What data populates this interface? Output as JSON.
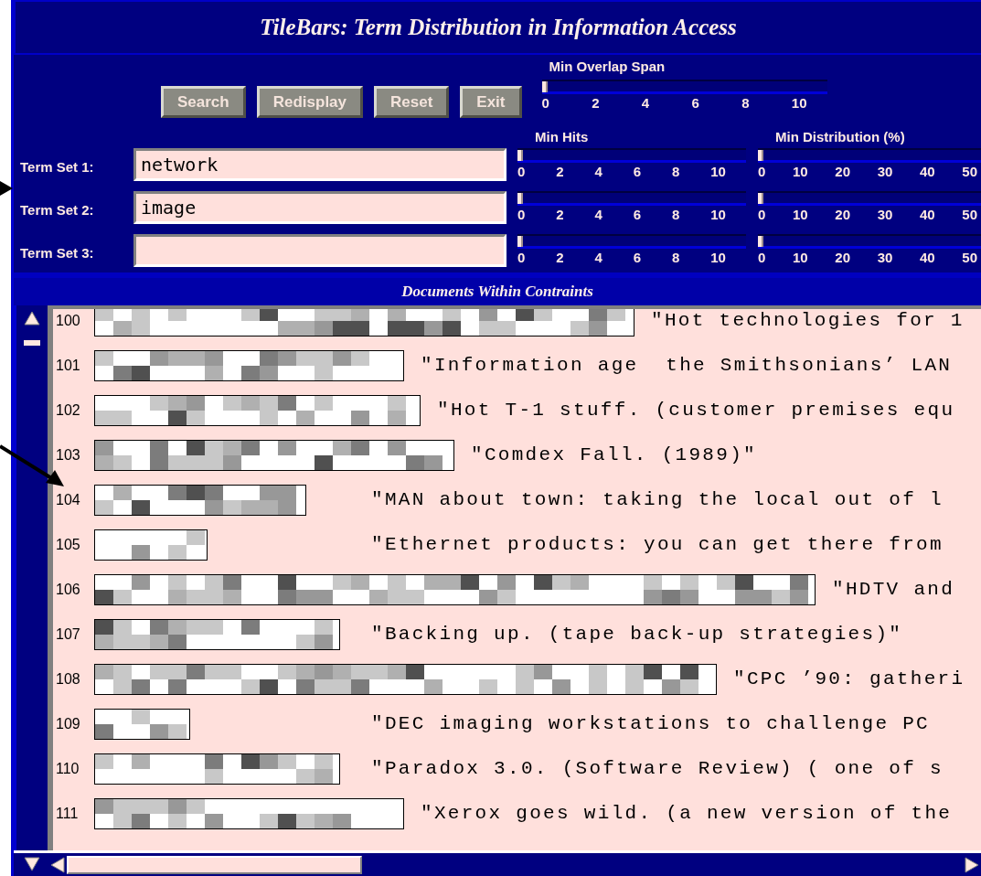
{
  "window": {
    "title": "TileBars: Term Distribution in Information Access"
  },
  "buttons": [
    "Search",
    "Redisplay",
    "Reset",
    "Exit"
  ],
  "overlap_slider": {
    "label": "Min Overlap Span",
    "level": 0,
    "ticks": [
      "0",
      "2",
      "4",
      "6",
      "8",
      "10"
    ]
  },
  "column_labels": {
    "min_hits": "Min Hits",
    "min_distribution": "Min Distribution (%)"
  },
  "term_sets": [
    {
      "label": "Term Set 1:",
      "value": "network",
      "min_hits": {
        "level": 0,
        "ticks": [
          "0",
          "2",
          "4",
          "6",
          "8",
          "10"
        ]
      },
      "min_distribution": {
        "level": 0,
        "ticks": [
          "0",
          "10",
          "20",
          "30",
          "40",
          "50"
        ]
      }
    },
    {
      "label": "Term Set 2:",
      "value": "image",
      "min_hits": {
        "level": 0,
        "ticks": [
          "0",
          "2",
          "4",
          "6",
          "8",
          "10"
        ]
      },
      "min_distribution": {
        "level": 0,
        "ticks": [
          "0",
          "10",
          "20",
          "30",
          "40",
          "50"
        ]
      }
    },
    {
      "label": "Term Set 3:",
      "min_hits": {
        "level": 0,
        "ticks": [
          "0",
          "2",
          "4",
          "6",
          "8",
          "10"
        ]
      },
      "min_distribution": {
        "level": 0,
        "ticks": [
          "0",
          "10",
          "20",
          "30",
          "40",
          "50"
        ]
      }
    }
  ],
  "results": {
    "header": "Documents Within Contraints",
    "rows": [
      {
        "number": "100",
        "title": "\"Hot technologies for 1"
      },
      {
        "number": "101",
        "title": "\"Information age  the Smithsonians’ LAN"
      },
      {
        "number": "102",
        "title": "\"Hot T-1 stuff. (customer premises equ"
      },
      {
        "number": "103",
        "title": "\"Comdex Fall. (1989)\""
      },
      {
        "number": "104",
        "title": "\"MAN about town: taking the local out of l"
      },
      {
        "number": "105",
        "title": "\"Ethernet products: you can get there from"
      },
      {
        "number": "106",
        "title": "\"HDTV and"
      },
      {
        "number": "107",
        "title": "\"Backing up. (tape back-up strategies)\""
      },
      {
        "number": "108",
        "title": "\"CPC ’90: gatheri"
      },
      {
        "number": "109",
        "title": "\"DEC imaging workstations to challenge PC"
      },
      {
        "number": "110",
        "title": "\"Paradox 3.0. (Software Review) ( one of s"
      },
      {
        "number": "111",
        "title": "\"Xerox goes wild. (a new version of the"
      }
    ]
  }
}
